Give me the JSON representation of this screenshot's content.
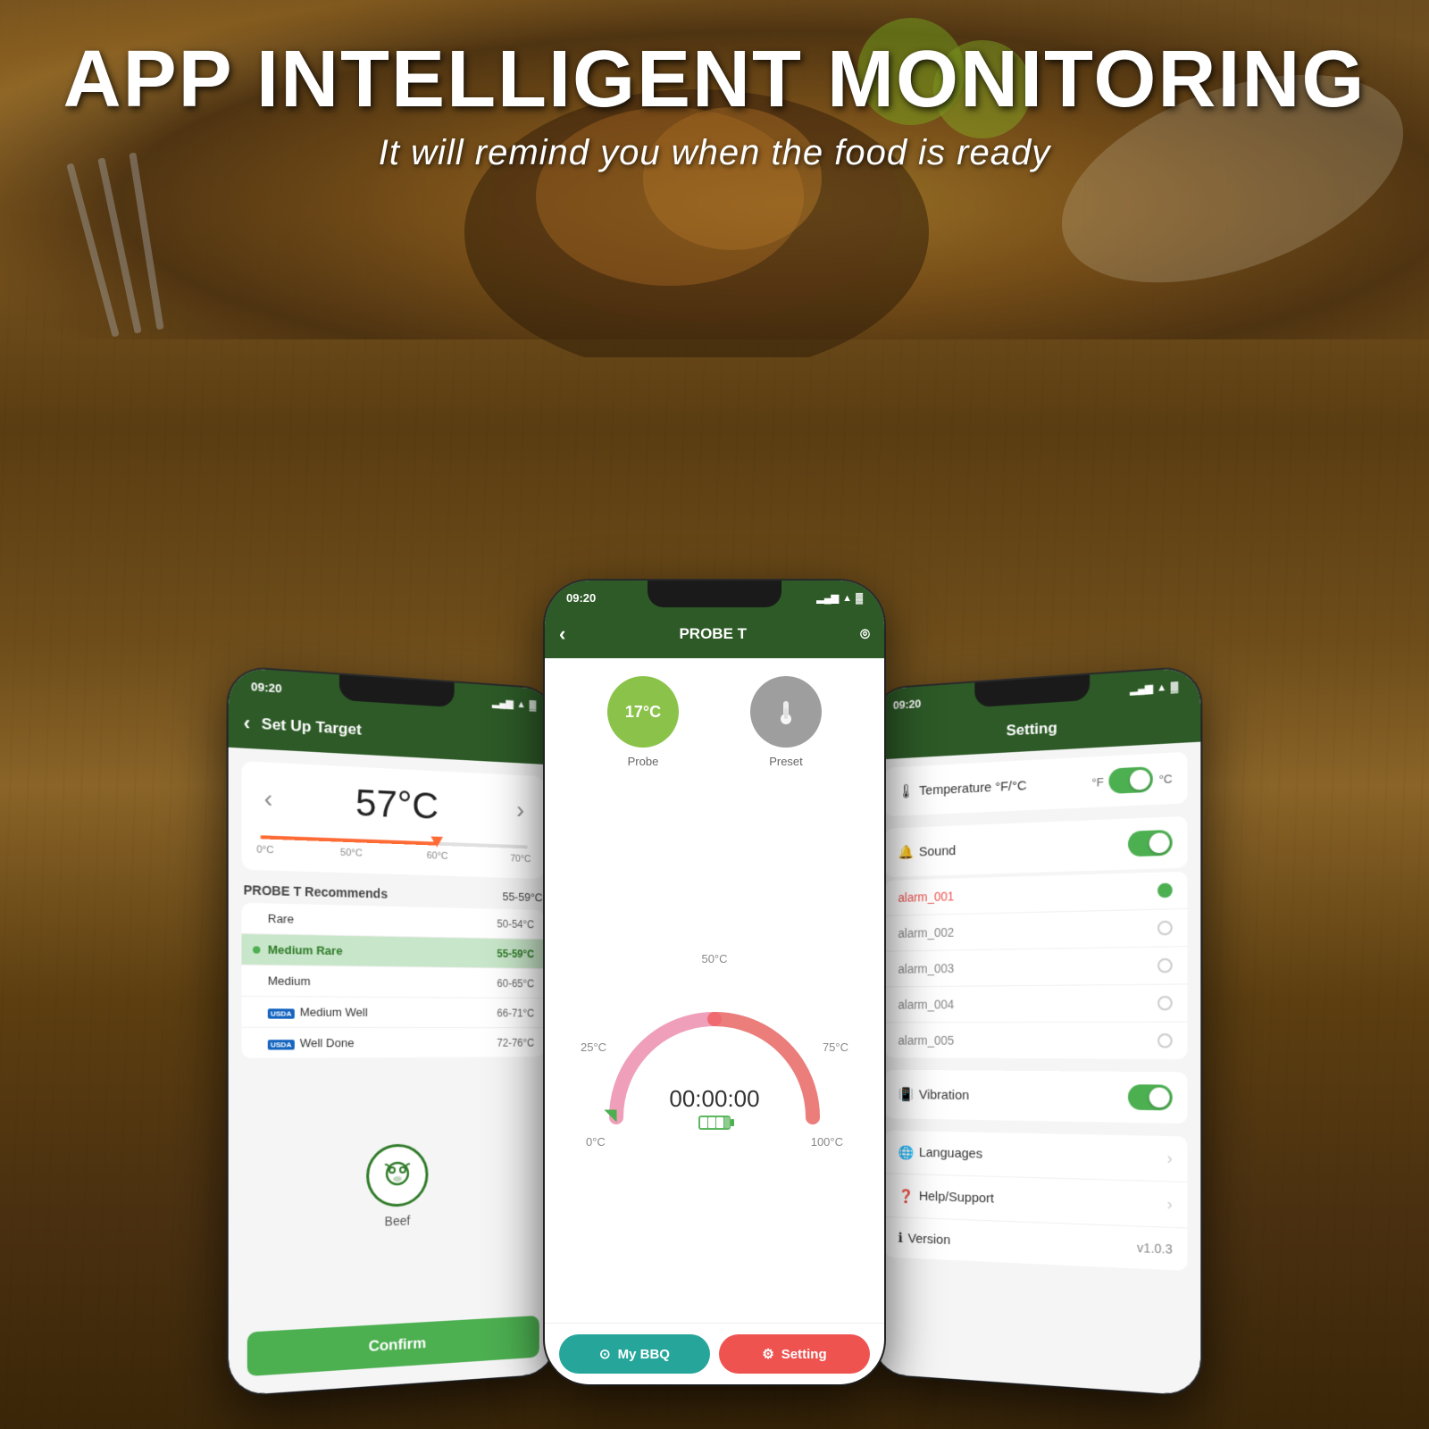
{
  "header": {
    "main_title": "APP INTELLIGENT MONITORING",
    "sub_title": "It will remind you when the food is ready"
  },
  "left_phone": {
    "status_time": "09:20",
    "screen_title": "Set Up Target",
    "temp_value": "57°C",
    "temp_labels": [
      "0°C",
      "50°C",
      "60°C",
      "70°C"
    ],
    "probe_recommends_label": "PROBE T  Recommends",
    "probe_recommends_range": "55-59°C",
    "meat_options": [
      {
        "name": "Rare",
        "range": "50-54°C",
        "highlighted": false,
        "usda": false
      },
      {
        "name": "Medium Rare",
        "range": "55-59°C",
        "highlighted": true,
        "usda": false
      },
      {
        "name": "Medium",
        "range": "60-65°C",
        "highlighted": false,
        "usda": false
      },
      {
        "name": "Medium Well",
        "range": "66-71°C",
        "highlighted": false,
        "usda": true
      },
      {
        "name": "Well Done",
        "range": "72-76°C",
        "highlighted": false,
        "usda": true
      }
    ],
    "food_label": "Beef",
    "confirm_label": "Confirm"
  },
  "center_phone": {
    "status_time": "09:20",
    "screen_title": "PROBE T",
    "probe_temp": "17°C",
    "probe_label": "Probe",
    "preset_label": "Preset",
    "timer_display": "00:00:00",
    "gauge_labels": {
      "left_bottom": "0°C",
      "right_bottom": "100°C",
      "left_mid": "25°C",
      "right_mid": "75°C",
      "top": "50°C"
    },
    "nav_my_bbq": "My BBQ",
    "nav_setting": "Setting"
  },
  "right_phone": {
    "status_time": "09:20",
    "screen_title": "Setting",
    "temperature_label": "Temperature  °F/°C",
    "temp_unit_f": "°F",
    "temp_unit_c": "°C",
    "temp_toggle": "on",
    "sound_label": "Sound",
    "sound_toggle": "on",
    "alarms": [
      {
        "name": "alarm_001",
        "active": true
      },
      {
        "name": "alarm_002",
        "active": false
      },
      {
        "name": "alarm_003",
        "active": false
      },
      {
        "name": "alarm_004",
        "active": false
      },
      {
        "name": "alarm_005",
        "active": false
      }
    ],
    "vibration_label": "Vibration",
    "vibration_toggle": "on",
    "languages_label": "Languages",
    "help_label": "Help/Support",
    "version_label": "Version",
    "version_value": "v1.0.3"
  },
  "icons": {
    "back": "‹",
    "wifi": "wifi",
    "signal": "signal",
    "battery": "battery",
    "thermometer": "🌡",
    "chevron_right": "›",
    "settings_gear": "⚙",
    "bbq_icon": "🔥",
    "sound_icon": "🔔",
    "vibration_icon": "📳",
    "languages_icon": "🌐",
    "help_icon": "❓",
    "version_icon": "ℹ"
  }
}
